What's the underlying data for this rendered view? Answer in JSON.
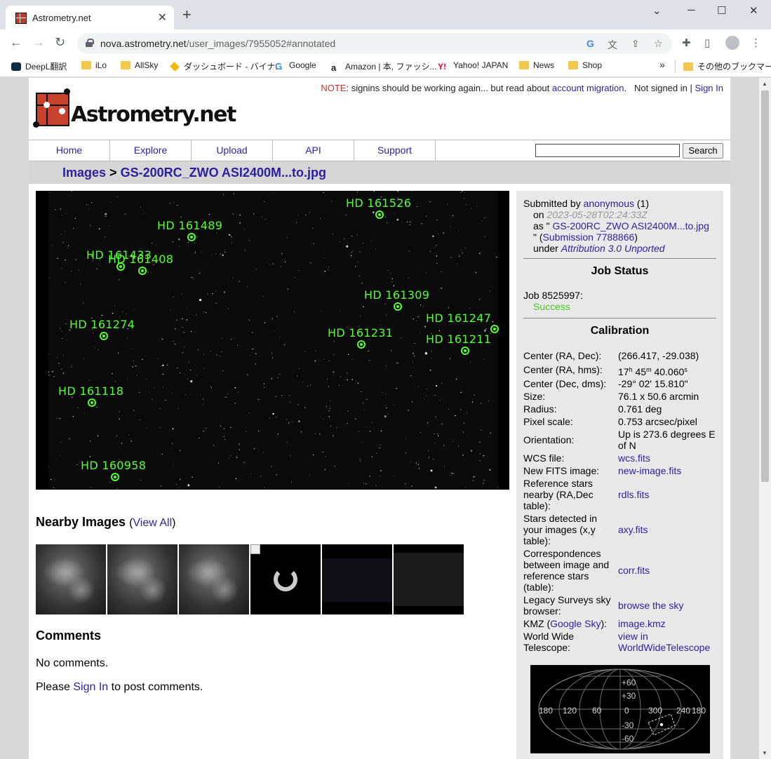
{
  "browser": {
    "tab_title": "Astrometry.net",
    "tab_close": "✕",
    "new_tab": "+",
    "url_host": "nova.astrometry.net",
    "url_path": "/user_images/7955052#annotated",
    "bookmarks": [
      {
        "label": "DeepL翻訳",
        "icon": "deepl-icon"
      },
      {
        "label": "iLo",
        "icon": "folder-icon"
      },
      {
        "label": "AllSky",
        "icon": "folder-icon"
      },
      {
        "label": "ダッシュボード - バイナ...",
        "icon": "binance-icon"
      },
      {
        "label": "Google",
        "icon": "google-icon"
      },
      {
        "label": "Amazon | 本, ファッシ...",
        "icon": "amazon-icon"
      },
      {
        "label": "Yahoo! JAPAN",
        "icon": "yahoo-icon"
      },
      {
        "label": "News",
        "icon": "folder-icon"
      },
      {
        "label": "Shop",
        "icon": "folder-icon"
      }
    ],
    "bookmarks_overflow": "»",
    "other_bookmarks": "その他のブックマーク"
  },
  "header": {
    "note_label": "NOTE",
    "note_text": ": signins should be working again... but read about ",
    "note_link": "account migration",
    "note_end": ".",
    "not_signed_in": "Not signed in",
    "separator": "|",
    "sign_in": "Sign In",
    "logo_text": "Astrometry.net"
  },
  "nav": {
    "items": [
      "Home",
      "Explore",
      "Upload",
      "API",
      "Support"
    ],
    "search_button": "Search"
  },
  "breadcrumb": {
    "root": "Images",
    "sep": " > ",
    "current": "GS-200RC_ZWO ASI2400M...to.jpg"
  },
  "annotations": [
    {
      "name": "HD 161526"
    },
    {
      "name": "HD 161489"
    },
    {
      "name": "HD 161433"
    },
    {
      "name": "HD 161408"
    },
    {
      "name": "HD 161309"
    },
    {
      "name": "HD 161274"
    },
    {
      "name": "HD 161247"
    },
    {
      "name": "HD 161231"
    },
    {
      "name": "HD 161211"
    },
    {
      "name": "HD 161118"
    },
    {
      "name": "HD 160958"
    }
  ],
  "nearby": {
    "title": "Nearby Images",
    "view_all_open": "(",
    "view_all": "View All",
    "view_all_close": ")"
  },
  "comments": {
    "title": "Comments",
    "none": "No comments.",
    "please": "Please ",
    "sign_in": "Sign In",
    "to_post": " to post comments."
  },
  "submission": {
    "submitted_by": "Submitted by ",
    "user": "anonymous",
    "user_count": " (1)",
    "on": "on ",
    "date": "2023-05-28T02:24:33Z",
    "as_prefix": "as \" ",
    "filename": "GS-200RC_ZWO ASI2400M...to.jpg",
    "as_suffix": "\" (",
    "submission_link": "Submission 7788866",
    "close_paren": ")",
    "under": "under ",
    "license": "Attribution 3.0 Unported"
  },
  "job_status": {
    "title": "Job Status",
    "job": "Job 8525997:",
    "status": "Success"
  },
  "calibration": {
    "title": "Calibration",
    "rows": [
      {
        "label": "Center (RA, Dec):",
        "value": "(266.417, -29.038)"
      },
      {
        "label": "Center (RA, hms):",
        "value": ""
      },
      {
        "label": "Center (Dec, dms):",
        "value": "-29° 02' 15.810\""
      },
      {
        "label": "Size:",
        "value": "76.1 x 50.6 arcmin"
      },
      {
        "label": "Radius:",
        "value": "0.761 deg"
      },
      {
        "label": "Pixel scale:",
        "value": "0.753 arcsec/pixel"
      },
      {
        "label": "Orientation:",
        "value": "Up is 273.6 degrees E of N"
      },
      {
        "label": "WCS file:",
        "value": "wcs.fits"
      },
      {
        "label": "New FITS image:",
        "value": "new-image.fits"
      },
      {
        "label": "Reference stars nearby (RA,Dec table):",
        "value": "rdls.fits"
      },
      {
        "label": "Stars detected in your images (x,y table):",
        "value": "axy.fits"
      },
      {
        "label": "Correspondences between image and reference stars (table):",
        "value": "corr.fits"
      },
      {
        "label": "Legacy Surveys sky browser:",
        "value": "browse the sky"
      },
      {
        "label": "KMZ (",
        "value": "image.kmz"
      },
      {
        "label": "World Wide Telescope:",
        "value": "view in WorldWideTelescope"
      }
    ],
    "ra_h": "17",
    "ra_h_unit": "h",
    "ra_m": " 45",
    "ra_m_unit": "m",
    "ra_s": " 40.060",
    "ra_s_unit": "s",
    "kmz_link": "Google Sky",
    "kmz_close": "):"
  },
  "skymap": {
    "lat_labels": [
      "+60",
      "+30",
      "0",
      "-30",
      "-60"
    ],
    "lon_labels": [
      "180",
      "120",
      "60",
      "0",
      "300",
      "240",
      "180"
    ]
  }
}
